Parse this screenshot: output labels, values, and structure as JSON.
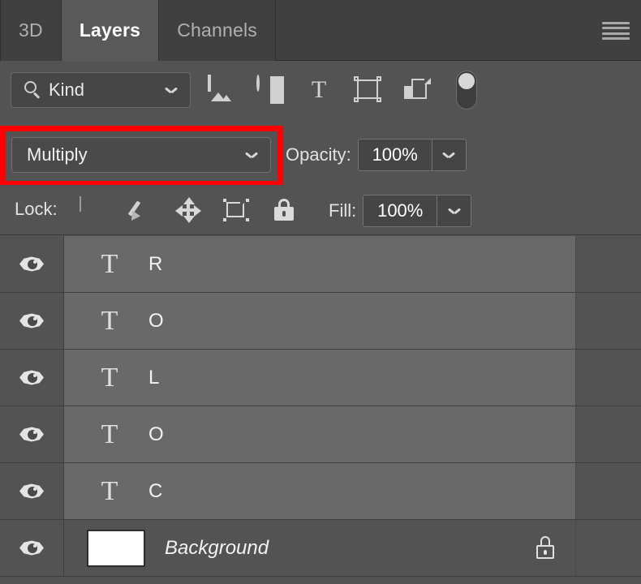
{
  "panel": {
    "tabs": [
      {
        "label": "3D",
        "active": false
      },
      {
        "label": "Layers",
        "active": true
      },
      {
        "label": "Channels",
        "active": false
      }
    ],
    "menu_icon": "hamburger-menu-icon"
  },
  "filter": {
    "kind_label": "Kind",
    "search_icon": "search-icon",
    "chevron_icon": "chevron-down-icon",
    "type_filters": [
      {
        "name": "filter-pixel-layers",
        "icon": "image-icon"
      },
      {
        "name": "filter-adjustment-layers",
        "icon": "adjustment-half-circle-icon"
      },
      {
        "name": "filter-type-layers",
        "icon": "type-t-icon",
        "glyph": "T"
      },
      {
        "name": "filter-shape-layers",
        "icon": "shape-frame-icon"
      },
      {
        "name": "filter-smart-objects",
        "icon": "smart-object-icon"
      }
    ],
    "toggle_name": "filter-enable-toggle"
  },
  "blend": {
    "mode": "Multiply",
    "opacity_label": "Opacity:",
    "opacity_value": "100%",
    "annotation_color": "#ff0000"
  },
  "lock": {
    "label": "Lock:",
    "buttons": [
      {
        "name": "lock-transparent-pixels",
        "icon": "checkerboard-icon"
      },
      {
        "name": "lock-image-pixels",
        "icon": "brush-icon"
      },
      {
        "name": "lock-position",
        "icon": "move-arrows-icon"
      },
      {
        "name": "lock-artboard-nesting",
        "icon": "artboard-icon"
      },
      {
        "name": "lock-all",
        "icon": "padlock-icon"
      }
    ],
    "fill_label": "Fill:",
    "fill_value": "100%"
  },
  "layers": [
    {
      "name": "R",
      "type": "text",
      "glyph": "T",
      "visible": true,
      "selected": true,
      "locked": false
    },
    {
      "name": "O",
      "type": "text",
      "glyph": "T",
      "visible": true,
      "selected": true,
      "locked": false
    },
    {
      "name": "L",
      "type": "text",
      "glyph": "T",
      "visible": true,
      "selected": true,
      "locked": false
    },
    {
      "name": "O",
      "type": "text",
      "glyph": "T",
      "visible": true,
      "selected": true,
      "locked": false
    },
    {
      "name": "C",
      "type": "text",
      "glyph": "T",
      "visible": true,
      "selected": true,
      "locked": false
    },
    {
      "name": "Background",
      "type": "image",
      "glyph": "",
      "visible": true,
      "selected": false,
      "locked": true
    }
  ],
  "colors": {
    "panel_bg": "#535353",
    "tabbar_bg": "#404040",
    "active_tab_bg": "#595959",
    "selected_row_bg": "#696969",
    "text": "#f0f0f0",
    "accent_annotation": "#ff0000"
  }
}
